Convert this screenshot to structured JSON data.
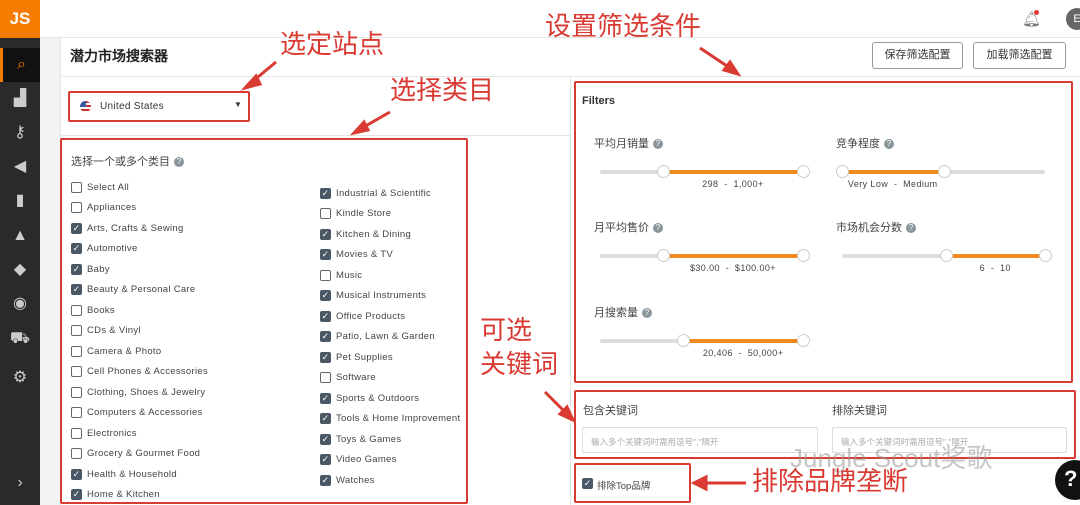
{
  "app": {
    "logo": "JS",
    "title": "潜力市场搜索器",
    "save_button": "保存筛选配置",
    "load_button": "加载筛选配置",
    "avatar": "E"
  },
  "sidebar": [
    "search-icon",
    "binoculars-icon",
    "key-icon",
    "megaphone-icon",
    "bar-chart-icon",
    "graduation-icon",
    "academy-icon",
    "chrome-icon",
    "cart-icon",
    "settings-icon"
  ],
  "marketplace": {
    "selected": "United States"
  },
  "categories": {
    "title": "选择一个或多个类目",
    "left": [
      [
        "Select All",
        false
      ],
      [
        "Appliances",
        false
      ],
      [
        "Arts, Crafts & Sewing",
        true
      ],
      [
        "Automotive",
        true
      ],
      [
        "Baby",
        true
      ],
      [
        "Beauty & Personal Care",
        true
      ],
      [
        "Books",
        false
      ],
      [
        "CDs & Vinyl",
        false
      ],
      [
        "Camera & Photo",
        false
      ],
      [
        "Cell Phones & Accessories",
        false
      ],
      [
        "Clothing, Shoes & Jewelry",
        false
      ],
      [
        "Computers & Accessories",
        false
      ],
      [
        "Electronics",
        false
      ],
      [
        "Grocery & Gourmet Food",
        false
      ],
      [
        "Health & Household",
        true
      ],
      [
        "Home & Kitchen",
        true
      ]
    ],
    "right": [
      [
        "Industrial & Scientific",
        true
      ],
      [
        "Kindle Store",
        false
      ],
      [
        "Kitchen & Dining",
        true
      ],
      [
        "Movies & TV",
        true
      ],
      [
        "Music",
        false
      ],
      [
        "Musical Instruments",
        true
      ],
      [
        "Office Products",
        true
      ],
      [
        "Patio, Lawn & Garden",
        true
      ],
      [
        "Pet Supplies",
        true
      ],
      [
        "Software",
        false
      ],
      [
        "Sports & Outdoors",
        true
      ],
      [
        "Tools & Home Improvement",
        true
      ],
      [
        "Toys & Games",
        true
      ],
      [
        "Video Games",
        true
      ],
      [
        "Watches",
        true
      ]
    ]
  },
  "filters": {
    "title": "Filters",
    "sliders": [
      {
        "label": "平均月销量",
        "min": "298",
        "max": "1,000+",
        "from": 0.31,
        "to": 1.0
      },
      {
        "label": "竞争程度",
        "min": "Very Low",
        "max": "Medium",
        "from": 0.0,
        "to": 0.5
      },
      {
        "label": "月平均售价",
        "min": "$30.00",
        "max": "$100.00+",
        "from": 0.31,
        "to": 1.0
      },
      {
        "label": "市场机会分数",
        "min": "6",
        "max": "10",
        "from": 0.51,
        "to": 1.0
      },
      {
        "label": "月搜索量",
        "min": "20,406",
        "max": "50,000+",
        "from": 0.41,
        "to": 1.0
      }
    ]
  },
  "keywords": {
    "include_label": "包含关键词",
    "exclude_label": "排除关键词",
    "placeholder": "输入多个关键词时需用逗号\",\"隔开"
  },
  "exclude_top_brands": {
    "label": "排除Top品牌",
    "checked": true
  },
  "annotations": {
    "site": "选定站点",
    "filters": "设置筛选条件",
    "category": "选择类目",
    "keywords1": "可选",
    "keywords2": "关键词",
    "brand": "排除品牌垄断"
  },
  "watermark": "Jungle Scout奖歌",
  "help": "?"
}
